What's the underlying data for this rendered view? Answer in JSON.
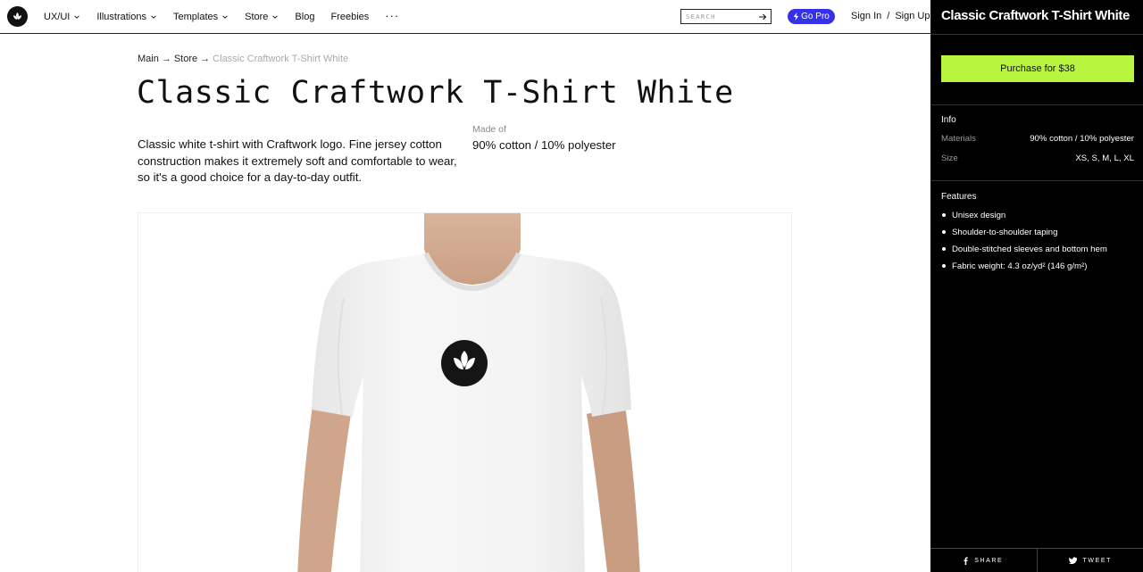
{
  "nav": {
    "items": [
      {
        "label": "UX/UI",
        "dropdown": true
      },
      {
        "label": "Illustrations",
        "dropdown": true
      },
      {
        "label": "Templates",
        "dropdown": true
      },
      {
        "label": "Store",
        "dropdown": true
      },
      {
        "label": "Blog",
        "dropdown": false
      },
      {
        "label": "Freebies",
        "dropdown": false
      }
    ],
    "more_label": "···",
    "search_placeholder": "SEARCH",
    "go_pro_label": "Go Pro",
    "sign_in": "Sign In",
    "auth_separator": "/",
    "sign_up": "Sign Up"
  },
  "breadcrumb": {
    "items": [
      "Main",
      "Store",
      "Classic Craftwork T-Shirt White"
    ],
    "separator": "→"
  },
  "product": {
    "title": "Classic Craftwork T-Shirt White",
    "description": "Classic white t-shirt with Craftwork logo. Fine jersey cotton construction makes it extremely soft and comfortable to wear, so it's a good choice for a day-to-day outfit.",
    "made_of_label": "Made of",
    "made_of_value": "90% cotton / 10% polyester"
  },
  "panel": {
    "title": "Classic Craftwork T-Shirt White",
    "purchase_label": "Purchase for $38",
    "info_title": "Info",
    "info": [
      {
        "key": "Materials",
        "value": "90% cotton / 10% polyester"
      },
      {
        "key": "Size",
        "value": "XS, S, M, L, XL"
      }
    ],
    "features_title": "Features",
    "features": [
      "Unisex design",
      "Shoulder-to-shoulder taping",
      "Double-stitched sleeves and bottom hem",
      "Fabric weight: 4.3 oz/yd² (146 g/m²)"
    ],
    "share_label": "SHARE",
    "tweet_label": "TWEET"
  },
  "colors": {
    "accent_purchase": "#b7f53f",
    "go_pro": "#3431e8",
    "panel_bg": "#000000"
  }
}
